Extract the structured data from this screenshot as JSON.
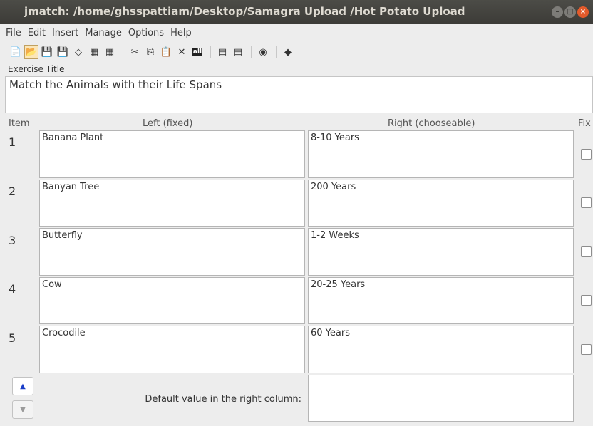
{
  "window": {
    "title": "jmatch: /home/ghsspattiam/Desktop/Samagra Upload /Hot Potato Upload"
  },
  "menu": [
    "File",
    "Edit",
    "Insert",
    "Manage",
    "Options",
    "Help"
  ],
  "toolbar": [
    {
      "name": "new-file-icon",
      "glyph": "📄"
    },
    {
      "name": "open-folder-icon",
      "glyph": "📂"
    },
    {
      "name": "save-icon",
      "glyph": "💾"
    },
    {
      "name": "save-as-icon",
      "glyph": "💾"
    },
    {
      "name": "eraser-icon",
      "glyph": "◇"
    },
    {
      "name": "web-page-icon",
      "glyph": "▦"
    },
    {
      "name": "web-page-dragdrop-icon",
      "glyph": "▦"
    },
    {
      "sep": true
    },
    {
      "name": "cut-icon",
      "glyph": "✂"
    },
    {
      "name": "copy-icon",
      "glyph": "⎘"
    },
    {
      "name": "paste-icon",
      "glyph": "📋"
    },
    {
      "name": "delete-icon",
      "glyph": "✕"
    },
    {
      "name": "select-all-icon",
      "glyph": "all"
    },
    {
      "sep": true
    },
    {
      "name": "add-pair-icon",
      "glyph": "▤"
    },
    {
      "name": "remove-pair-icon",
      "glyph": "▤"
    },
    {
      "sep": true
    },
    {
      "name": "config-icon",
      "glyph": "◉"
    },
    {
      "sep": true
    },
    {
      "name": "help-icon",
      "glyph": "◆"
    }
  ],
  "exercise": {
    "label": "Exercise Title",
    "value": "Match the Animals with their Life Spans"
  },
  "headers": {
    "item": "Item",
    "left": "Left (fixed)",
    "right": "Right (chooseable)",
    "fix": "Fix"
  },
  "rows": [
    {
      "num": "1",
      "left": "Banana Plant",
      "right": "8-10 Years",
      "fixed": false
    },
    {
      "num": "2",
      "left": "Banyan Tree",
      "right": "200 Years",
      "fixed": false
    },
    {
      "num": "3",
      "left": "Butterfly",
      "right": "1-2 Weeks",
      "fixed": false
    },
    {
      "num": "4",
      "left": "Cow",
      "right": "20-25 Years",
      "fixed": false
    },
    {
      "num": "5",
      "left": "Crocodile",
      "right": "60 Years",
      "fixed": false
    }
  ],
  "footer": {
    "default_label": "Default value in the right column:",
    "default_value": "",
    "up_glyph": "▲",
    "down_glyph": "▼"
  }
}
